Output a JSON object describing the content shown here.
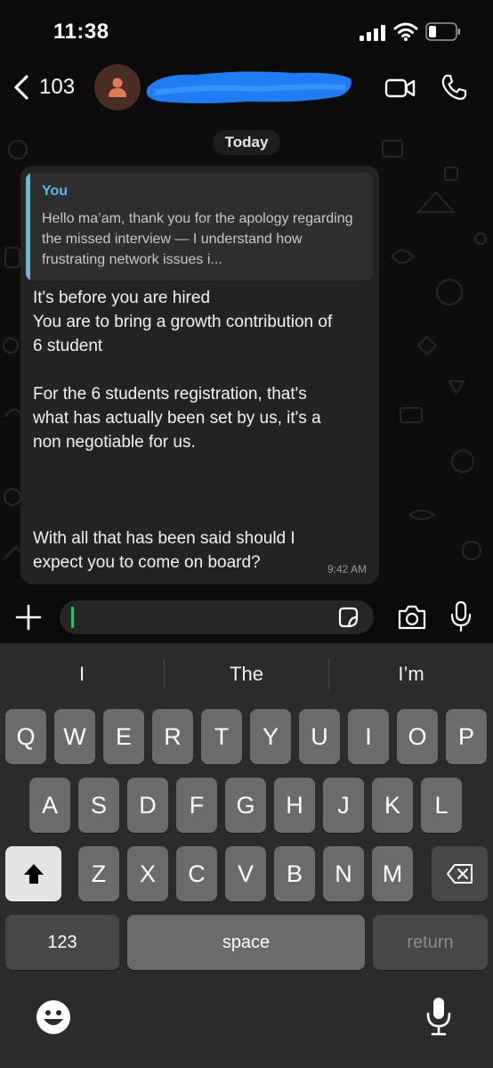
{
  "status_bar": {
    "time": "11:38"
  },
  "header": {
    "back_count": "103",
    "contact_prefix": "+"
  },
  "chat": {
    "date_chip": "Today",
    "message": {
      "quote_author": "You",
      "quote_text": "Hello ma’am, thank you for the apology regarding the missed interview — I understand how frustrating network issues i...",
      "lines": [
        "It's before you are hired",
        "You are to bring a growth contribution of",
        "6 student",
        "For the 6 students registration, that's",
        "what has actually been set by us,  it's a",
        "non negotiable for us.",
        "With all that has been said should I",
        "expect you to come on board?"
      ],
      "time": "9:42 AM"
    }
  },
  "input": {
    "placeholder": ""
  },
  "keyboard": {
    "suggestions": [
      "I",
      "The",
      "I’m"
    ],
    "row1": [
      "Q",
      "W",
      "E",
      "R",
      "T",
      "Y",
      "U",
      "I",
      "O",
      "P"
    ],
    "row2": [
      "A",
      "S",
      "D",
      "F",
      "G",
      "H",
      "J",
      "K",
      "L"
    ],
    "row3": [
      "Z",
      "X",
      "C",
      "V",
      "B",
      "N",
      "M"
    ],
    "numbers": "123",
    "space": "space",
    "return": "return"
  },
  "colors": {
    "accent_green": "#27c15e",
    "quote_blue": "#5eb8e6",
    "avatar_orange": "#e07a54"
  },
  "icons": [
    "back-chevron-icon",
    "person-icon",
    "video-call-icon",
    "phone-icon",
    "plus-icon",
    "sticker-icon",
    "camera-icon",
    "microphone-icon",
    "shift-icon",
    "backspace-icon",
    "emoji-icon",
    "dictation-icon"
  ]
}
